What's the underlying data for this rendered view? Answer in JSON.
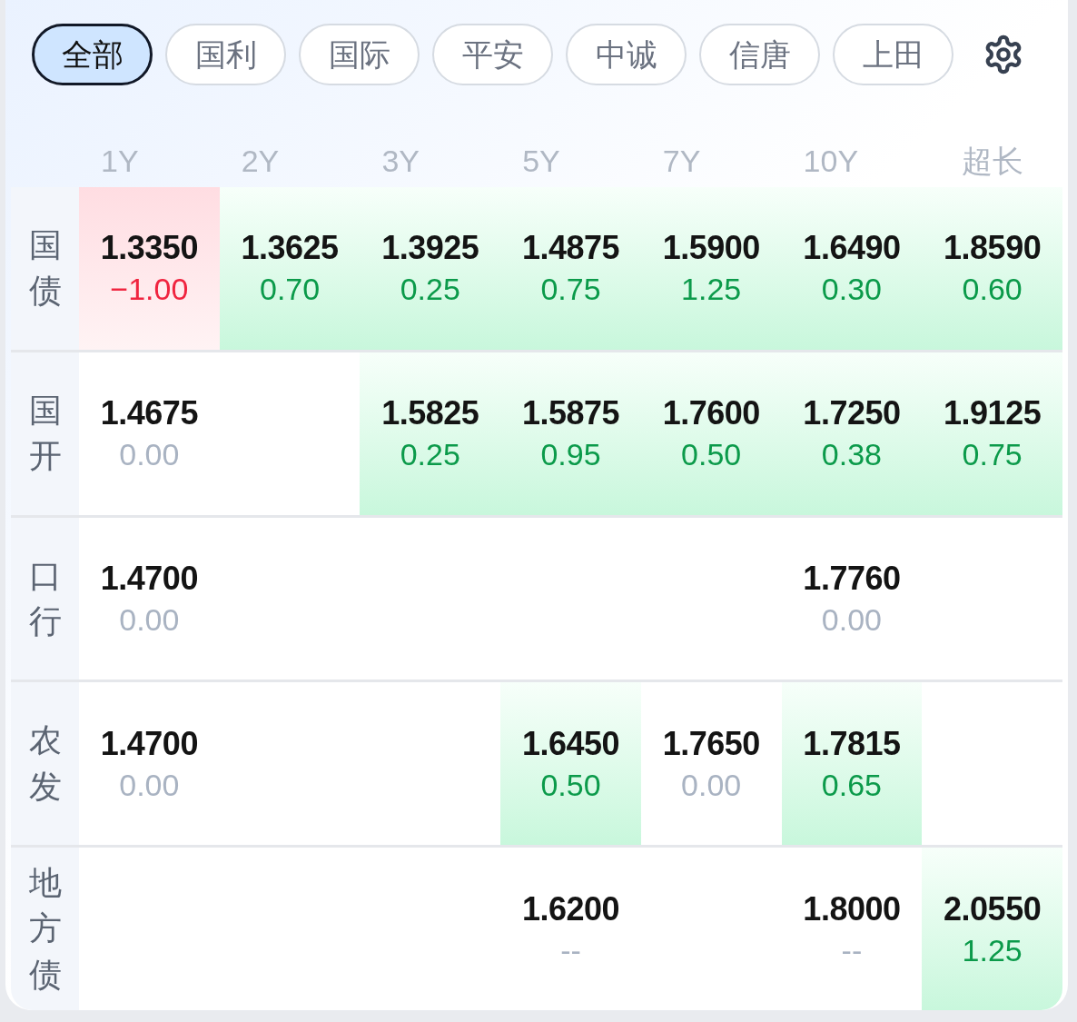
{
  "filters": [
    {
      "label": "全部",
      "selected": true
    },
    {
      "label": "国利",
      "selected": false
    },
    {
      "label": "国际",
      "selected": false
    },
    {
      "label": "平安",
      "selected": false
    },
    {
      "label": "中诚",
      "selected": false
    },
    {
      "label": "信唐",
      "selected": false
    },
    {
      "label": "上田",
      "selected": false
    }
  ],
  "columns": [
    "1Y",
    "2Y",
    "3Y",
    "5Y",
    "7Y",
    "10Y",
    "超长"
  ],
  "rows": [
    {
      "label": "国债",
      "cells": [
        {
          "value": "1.3350",
          "change": "−1.00",
          "kind": "down"
        },
        {
          "value": "1.3625",
          "change": "0.70",
          "kind": "up"
        },
        {
          "value": "1.3925",
          "change": "0.25",
          "kind": "up"
        },
        {
          "value": "1.4875",
          "change": "0.75",
          "kind": "up"
        },
        {
          "value": "1.5900",
          "change": "1.25",
          "kind": "up"
        },
        {
          "value": "1.6490",
          "change": "0.30",
          "kind": "up"
        },
        {
          "value": "1.8590",
          "change": "0.60",
          "kind": "up"
        }
      ]
    },
    {
      "label": "国开",
      "cells": [
        {
          "value": "1.4675",
          "change": "0.00",
          "kind": "flat"
        },
        null,
        {
          "value": "1.5825",
          "change": "0.25",
          "kind": "up"
        },
        {
          "value": "1.5875",
          "change": "0.95",
          "kind": "up"
        },
        {
          "value": "1.7600",
          "change": "0.50",
          "kind": "up"
        },
        {
          "value": "1.7250",
          "change": "0.38",
          "kind": "up"
        },
        {
          "value": "1.9125",
          "change": "0.75",
          "kind": "up"
        }
      ]
    },
    {
      "label": "口行",
      "cells": [
        {
          "value": "1.4700",
          "change": "0.00",
          "kind": "flat"
        },
        null,
        null,
        null,
        null,
        {
          "value": "1.7760",
          "change": "0.00",
          "kind": "flat"
        },
        null
      ]
    },
    {
      "label": "农发",
      "cells": [
        {
          "value": "1.4700",
          "change": "0.00",
          "kind": "flat"
        },
        null,
        null,
        {
          "value": "1.6450",
          "change": "0.50",
          "kind": "up"
        },
        {
          "value": "1.7650",
          "change": "0.00",
          "kind": "flat"
        },
        {
          "value": "1.7815",
          "change": "0.65",
          "kind": "up"
        },
        null
      ]
    },
    {
      "label": "地方债",
      "cells": [
        null,
        null,
        null,
        {
          "value": "1.6200",
          "change": "--",
          "kind": "flat"
        },
        null,
        {
          "value": "1.8000",
          "change": "--",
          "kind": "flat"
        },
        {
          "value": "2.0550",
          "change": "1.25",
          "kind": "up"
        }
      ]
    }
  ]
}
